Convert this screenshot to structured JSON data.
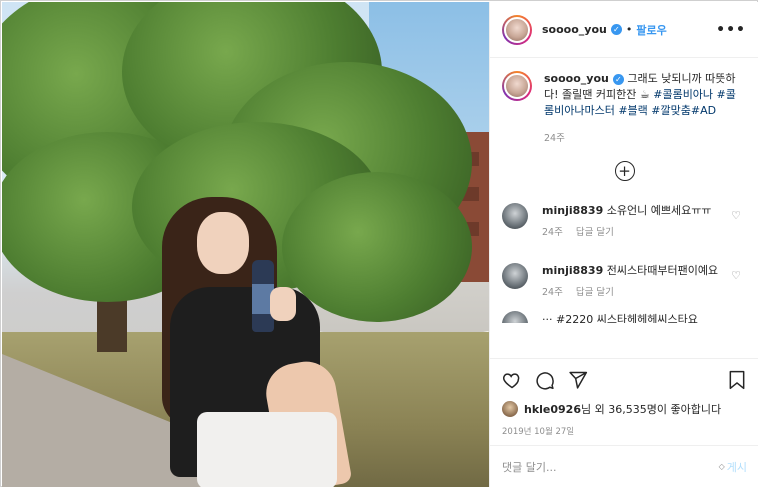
{
  "post": {
    "username": "soooo_you",
    "follow_label": "팔로우",
    "more_label": "•••"
  },
  "caption": {
    "username": "soooo_you",
    "text": "그래도 낮되니까 따뜻하다! 졸릴땐 커피한잔 ☕",
    "hashtags": "#콜롬비아나 #콜롬비아나마스터 #블랙 #깔맞춤#AD",
    "time": "24주"
  },
  "comments": [
    {
      "username": "minji8839",
      "text": "소유언니 예쁘세요ㅠㅠ",
      "time": "24주",
      "reply": "답글 달기"
    },
    {
      "username": "minji8839",
      "text": "전씨스타때부터팬이예요",
      "time": "24주",
      "reply": "답글 달기"
    }
  ],
  "partial_comment": "··· #2220 씨스타헤헤헤씨스타요",
  "likes": {
    "name": "hkle0926",
    "text": "님 외 36,535명이 좋아합니다"
  },
  "date": "2019년 10월 27일",
  "add_comment": {
    "placeholder": "댓글 달기...",
    "post_label": "게시"
  }
}
